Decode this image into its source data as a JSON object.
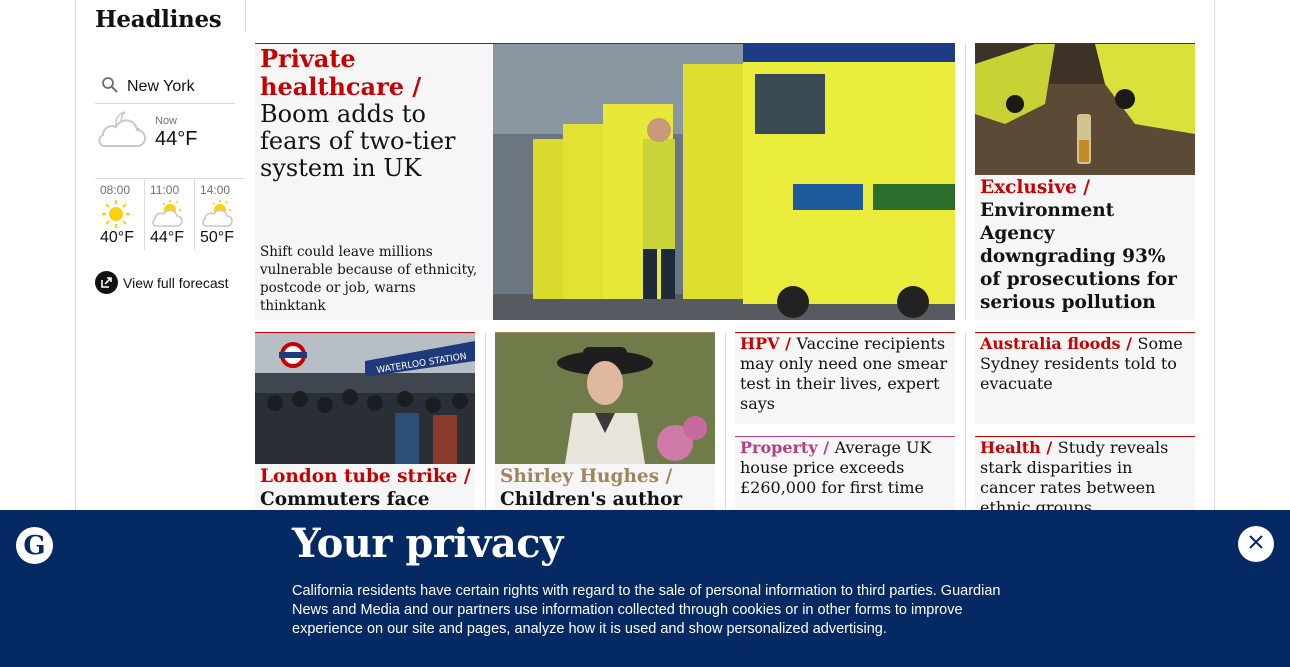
{
  "section": {
    "title": "Headlines"
  },
  "weather": {
    "location": "New York",
    "now_label": "Now",
    "now_temp": "44°F",
    "now_icon": "partly-cloudy-night-icon",
    "forecast": [
      {
        "time": "08:00",
        "temp": "40°F",
        "icon": "sun-icon"
      },
      {
        "time": "11:00",
        "temp": "44°F",
        "icon": "partly-sunny-icon"
      },
      {
        "time": "14:00",
        "temp": "50°F",
        "icon": "partly-sunny-icon"
      }
    ],
    "full_forecast_label": "View full forecast"
  },
  "stories": {
    "main": {
      "kicker": "Private healthcare",
      "separator": " / ",
      "headline": "Boom adds to fears of two-tier system in UK",
      "trail": "Shift could leave millions vulnerable because of ethnicity, postcode or job, warns thinktank",
      "image_alt": "Ambulances parked in a row with a paramedic"
    },
    "env": {
      "kicker": "Exclusive",
      "separator": " / ",
      "headline": "Environment Agency downgrading 93% of prosecutions for serious pollution"
    },
    "hpv": {
      "kicker": "HPV",
      "separator": " / ",
      "headline": "Vaccine recipients may only need one smear test in their lives, expert says"
    },
    "floods": {
      "kicker": "Australia floods",
      "separator": " / ",
      "headline": "Some Sydney residents told to evacuate"
    },
    "property": {
      "kicker": "Property",
      "separator": " / ",
      "headline": "Average UK house price exceeds £260,000 for first time"
    },
    "health": {
      "kicker": "Health",
      "separator": " / ",
      "headline": "Study reveals stark disparities in cancer rates between ethnic groups"
    },
    "tube": {
      "kicker": "London tube strike",
      "separator": " / ",
      "headline": "Commuters face"
    },
    "shirley": {
      "kicker": "Shirley Hughes",
      "separator": " / ",
      "headline": "Children's author and"
    }
  },
  "privacy": {
    "title": "Your privacy",
    "body": "California residents have certain rights with regard to the sale of personal information to third parties. Guardian News and Media and our partners use information collected through cookies or in other forms to improve experience on our site and pages, analyze how it is used and show personalized advertising.",
    "logo_text": "G"
  },
  "colors": {
    "news_red": "#c70000",
    "property_pink": "#bb3b80",
    "culture_tan": "#a1845c",
    "banner_blue": "#052962",
    "card_bg": "#f6f6f6"
  }
}
